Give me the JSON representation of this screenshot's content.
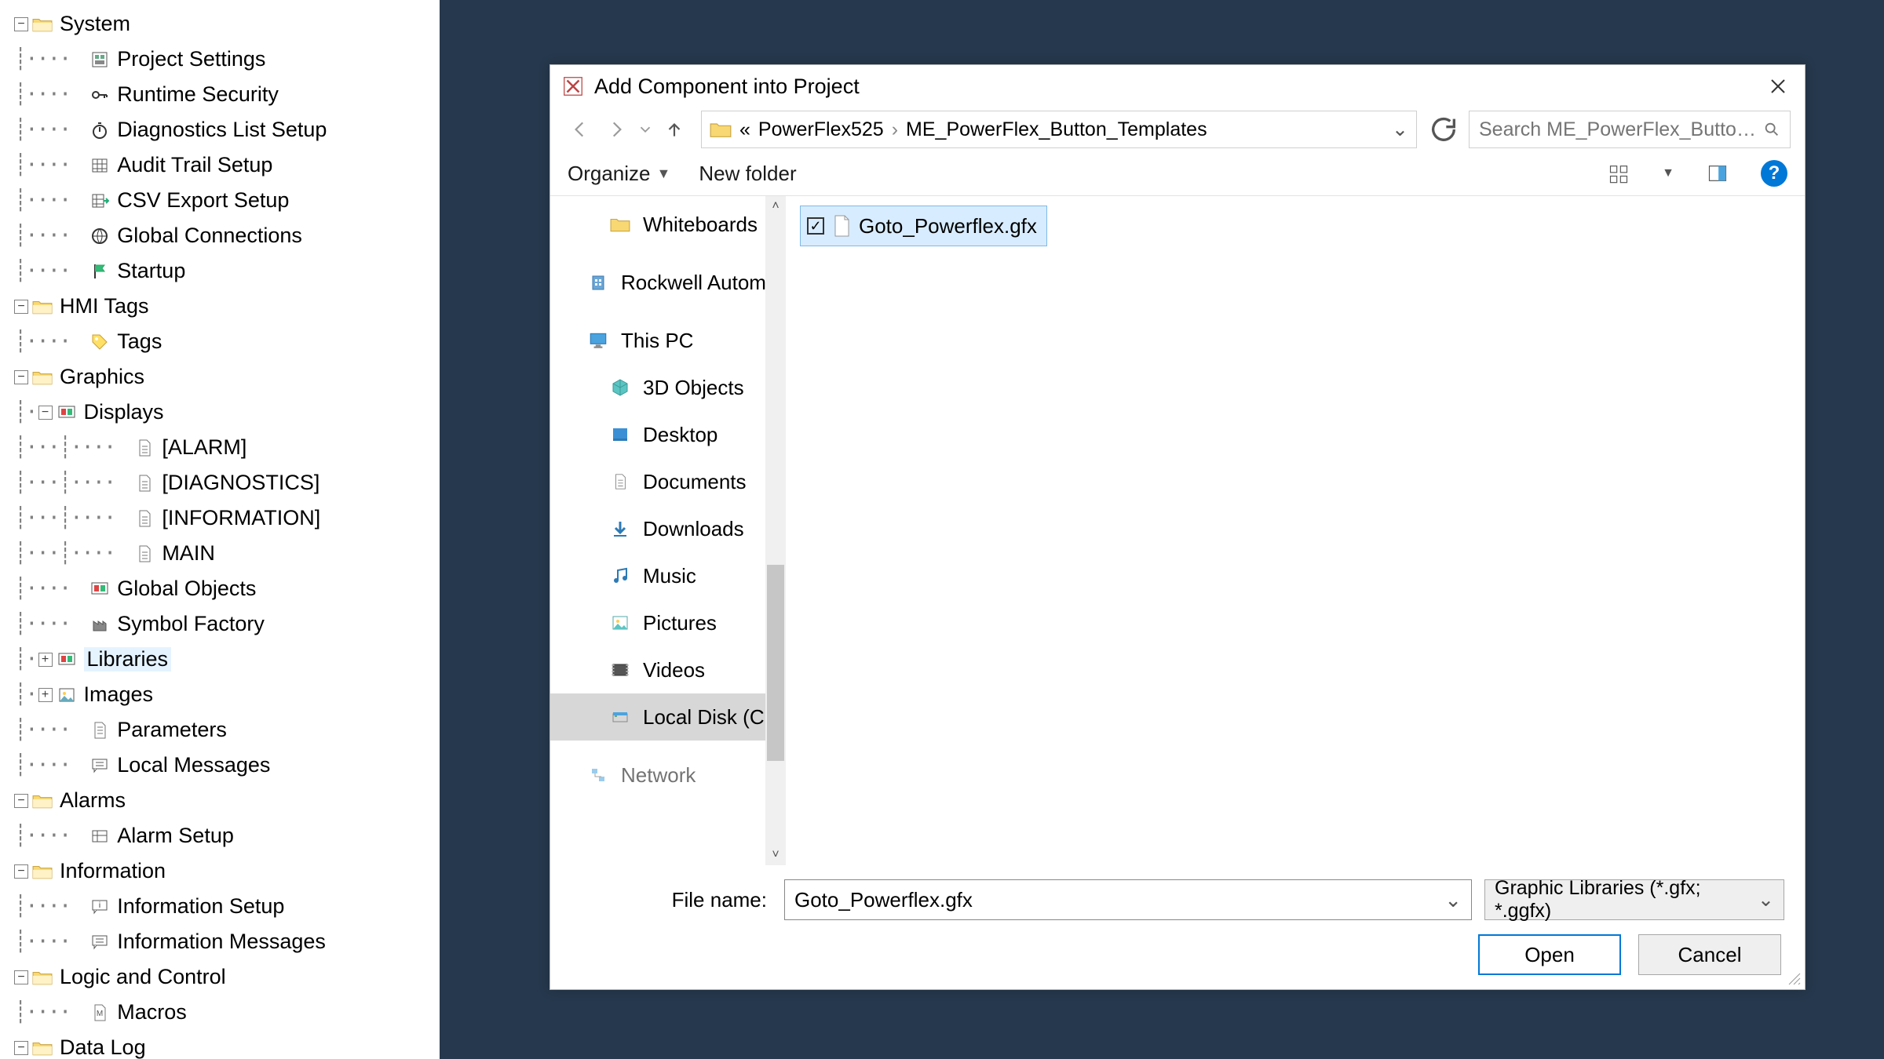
{
  "tree": {
    "system": "System",
    "project_settings": "Project Settings",
    "runtime_security": "Runtime Security",
    "diagnostics_list_setup": "Diagnostics List Setup",
    "audit_trail_setup": "Audit Trail Setup",
    "csv_export_setup": "CSV Export Setup",
    "global_connections": "Global Connections",
    "startup": "Startup",
    "hmi_tags": "HMI Tags",
    "tags": "Tags",
    "graphics": "Graphics",
    "displays": "Displays",
    "display_alarm": "[ALARM]",
    "display_diag": "[DIAGNOSTICS]",
    "display_info": "[INFORMATION]",
    "display_main": "MAIN",
    "global_objects": "Global Objects",
    "symbol_factory": "Symbol Factory",
    "libraries": "Libraries",
    "images": "Images",
    "parameters": "Parameters",
    "local_messages": "Local Messages",
    "alarms": "Alarms",
    "alarm_setup": "Alarm Setup",
    "information": "Information",
    "information_setup": "Information Setup",
    "information_messages": "Information Messages",
    "logic_and_control": "Logic and Control",
    "macros": "Macros",
    "data_log": "Data Log"
  },
  "dialog": {
    "title": "Add Component into Project",
    "breadcrumb_prefix": "«",
    "crumb1": "PowerFlex525",
    "crumb2": "ME_PowerFlex_Button_Templates",
    "search_placeholder": "Search ME_PowerFlex_Button...",
    "toolbar": {
      "organize": "Organize",
      "new_folder": "New folder"
    },
    "nav": {
      "whiteboards": "Whiteboards",
      "rockwell": "Rockwell Automa",
      "this_pc": "This PC",
      "three_d": "3D Objects",
      "desktop": "Desktop",
      "documents": "Documents",
      "downloads": "Downloads",
      "music": "Music",
      "pictures": "Pictures",
      "videos": "Videos",
      "local_disk": "Local Disk (C:)",
      "network": "Network"
    },
    "file_item": "Goto_Powerflex.gfx",
    "footer": {
      "file_name_label": "File name:",
      "file_name_value": "Goto_Powerflex.gfx",
      "type_filter": "Graphic Libraries (*.gfx; *.ggfx)",
      "open": "Open",
      "cancel": "Cancel"
    }
  }
}
